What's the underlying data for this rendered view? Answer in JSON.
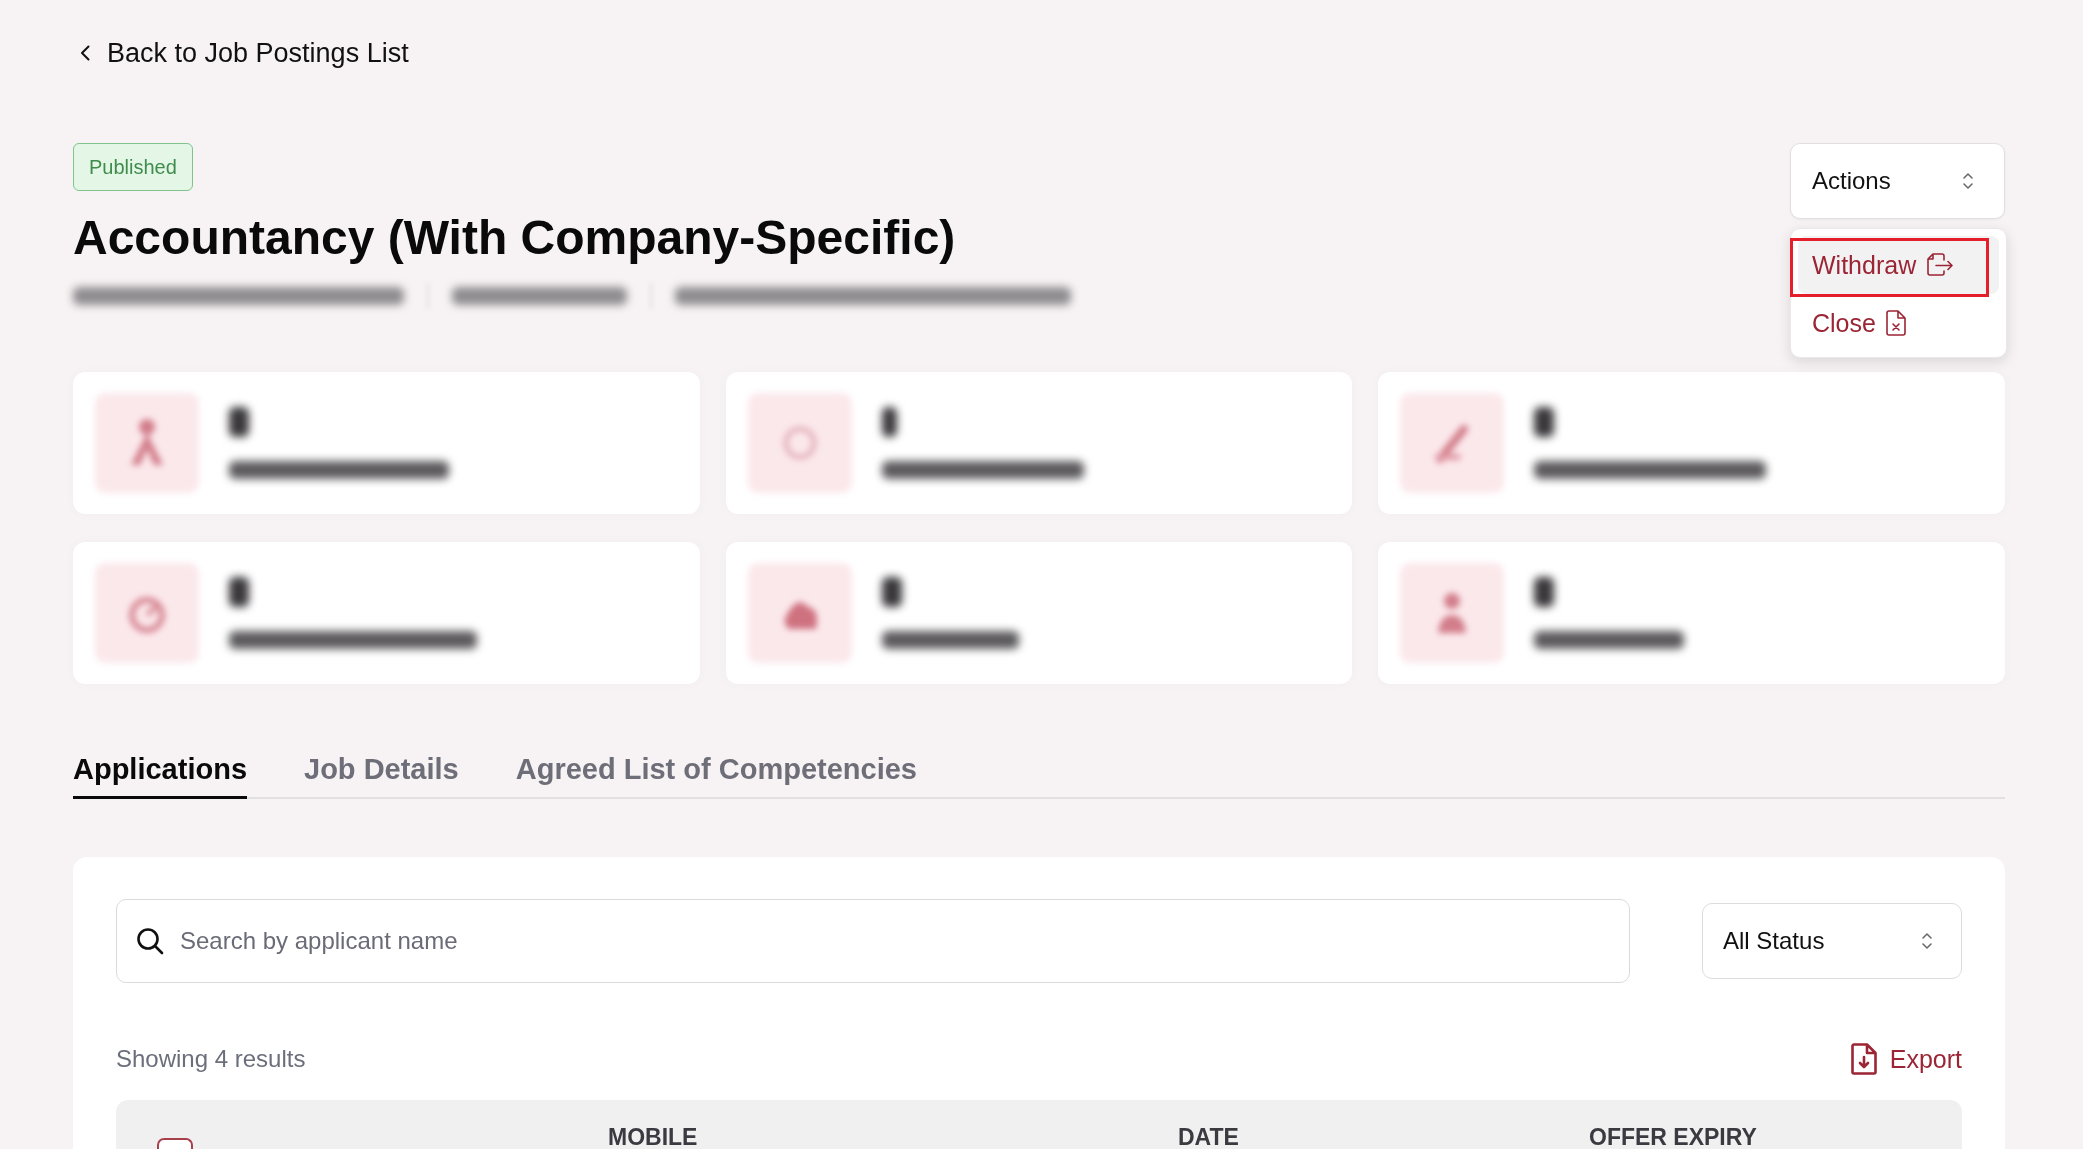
{
  "back_link": {
    "label": "Back to Job Postings List"
  },
  "header": {
    "status_badge": "Published",
    "title": "Accountancy (With Company-Specific)",
    "subtitle": {
      "blurred": true
    }
  },
  "actions": {
    "label": "Actions",
    "expanded": true,
    "menu": [
      {
        "kind": "withdraw",
        "label": "Withdraw",
        "hovered": true,
        "highlighted": true
      },
      {
        "kind": "close",
        "label": "Close",
        "hovered": false,
        "highlighted": false
      }
    ]
  },
  "stat_cards": [
    {
      "blurred": true
    },
    {
      "blurred": true
    },
    {
      "blurred": true
    },
    {
      "blurred": true
    },
    {
      "blurred": true
    },
    {
      "blurred": true
    }
  ],
  "tabs": [
    {
      "label": "Applications",
      "selected": true
    },
    {
      "label": "Job Details",
      "selected": false
    },
    {
      "label": "Agreed List of Competencies",
      "selected": false
    }
  ],
  "applications": {
    "search": {
      "placeholder": "Search by applicant name"
    },
    "status_filter": {
      "value": "All Status"
    },
    "results": "Showing 4 results",
    "export": {
      "label": "Export"
    },
    "table": {
      "columns": [
        {
          "kind": "checkbox",
          "checked": false
        },
        {
          "kind": "text"
        },
        {
          "kind": "text",
          "label": "MOBILE"
        },
        {
          "kind": "text"
        },
        {
          "kind": "text",
          "label": "DATE"
        },
        {
          "kind": "text"
        },
        {
          "kind": "text",
          "label": "OFFER EXPIRY"
        }
      ]
    }
  }
}
